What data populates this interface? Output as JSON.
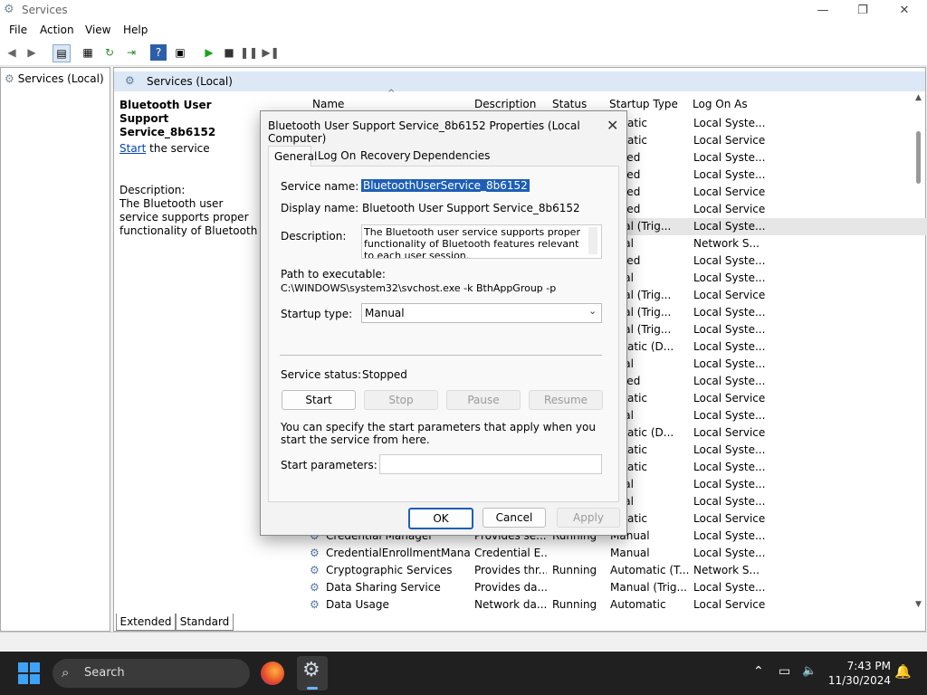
{
  "window": {
    "title": "Services",
    "min": "—",
    "restore": "❐",
    "close": "✕"
  },
  "menu": [
    "File",
    "Action",
    "View",
    "Help"
  ],
  "tree": {
    "root": "Services (Local)"
  },
  "main": {
    "header": "Services (Local)",
    "selected_service": "Bluetooth User Support Service_8b6152",
    "start_link": "Start",
    "start_suffix": " the service",
    "description_label": "Description:",
    "description": "The Bluetooth user service supports proper functionality of Bluetooth features relevant to each user session.",
    "columns": [
      "Name",
      "Description",
      "Status",
      "Startup Type",
      "Log On As"
    ],
    "rows_visible_right": [
      {
        "startup": "omatic",
        "logon": "Local Syste..."
      },
      {
        "startup": "omatic",
        "logon": "Local Service"
      },
      {
        "startup": "abled",
        "logon": "Local Syste..."
      },
      {
        "startup": "abled",
        "logon": "Local Syste..."
      },
      {
        "startup": "abled",
        "logon": "Local Service"
      },
      {
        "startup": "abled",
        "logon": "Local Service"
      },
      {
        "startup": "nual (Trig...",
        "logon": "Local Syste..."
      },
      {
        "startup": "nual",
        "logon": "Network S..."
      },
      {
        "startup": "abled",
        "logon": "Local Syste..."
      },
      {
        "startup": "nual",
        "logon": "Local Syste..."
      },
      {
        "startup": "nual (Trig...",
        "logon": "Local Service"
      },
      {
        "startup": "nual (Trig...",
        "logon": "Local Syste..."
      },
      {
        "startup": "nual (Trig...",
        "logon": "Local Syste..."
      },
      {
        "startup": "omatic (D...",
        "logon": "Local Syste..."
      },
      {
        "startup": "nual",
        "logon": "Local Syste..."
      },
      {
        "startup": "abled",
        "logon": "Local Syste..."
      },
      {
        "startup": "omatic",
        "logon": "Local Service"
      },
      {
        "startup": "nual",
        "logon": "Local Syste..."
      },
      {
        "startup": "omatic (D...",
        "logon": "Local Service"
      },
      {
        "startup": "omatic",
        "logon": "Local Syste..."
      },
      {
        "startup": "omatic",
        "logon": "Local Syste..."
      },
      {
        "startup": "nual",
        "logon": "Local Syste..."
      },
      {
        "startup": "nual",
        "logon": "Local Syste..."
      },
      {
        "startup": "omatic",
        "logon": "Local Service"
      }
    ],
    "rows_full": [
      {
        "name": "Credential Manager",
        "desc": "Provides se...",
        "status": "Running",
        "startup": "Manual",
        "logon": "Local Syste..."
      },
      {
        "name": "CredentialEnrollmentMana...",
        "desc": "Credential E...",
        "status": "",
        "startup": "Manual",
        "logon": "Local Syste..."
      },
      {
        "name": "Cryptographic Services",
        "desc": "Provides thr...",
        "status": "Running",
        "startup": "Automatic (T...",
        "logon": "Network S..."
      },
      {
        "name": "Data Sharing Service",
        "desc": "Provides da...",
        "status": "",
        "startup": "Manual (Trig...",
        "logon": "Local Syste..."
      },
      {
        "name": "Data Usage",
        "desc": "Network da...",
        "status": "Running",
        "startup": "Automatic",
        "logon": "Local Service"
      }
    ],
    "tabs": [
      "Extended",
      "Standard"
    ]
  },
  "dialog": {
    "title": "Bluetooth User Support Service_8b6152 Properties (Local Computer)",
    "tabs": [
      "General",
      "Log On",
      "Recovery",
      "Dependencies"
    ],
    "service_name_label": "Service name:",
    "service_name": "BluetoothUserService_8b6152",
    "display_name_label": "Display name:",
    "display_name": "Bluetooth User Support Service_8b6152",
    "description_label": "Description:",
    "description": "The Bluetooth user service supports proper functionality of Bluetooth features relevant to each user session.",
    "path_label": "Path to executable:",
    "path": "C:\\WINDOWS\\system32\\svchost.exe -k BthAppGroup -p",
    "startup_label": "Startup type:",
    "startup_value": "Manual",
    "status_label": "Service status:",
    "status_value": "Stopped",
    "btn_start": "Start",
    "btn_stop": "Stop",
    "btn_pause": "Pause",
    "btn_resume": "Resume",
    "params_hint": "You can specify the start parameters that apply when you start the service from here.",
    "params_label": "Start parameters:",
    "params_value": "",
    "ok": "OK",
    "cancel": "Cancel",
    "apply": "Apply"
  },
  "taskbar": {
    "search_label": "Search",
    "time": "7:43 PM",
    "date": "11/30/2024"
  },
  "colors": {
    "accent": "#1e5fb5",
    "selection": "#1e5fb5",
    "link": "#0645ad",
    "taskbar": "#202020"
  }
}
